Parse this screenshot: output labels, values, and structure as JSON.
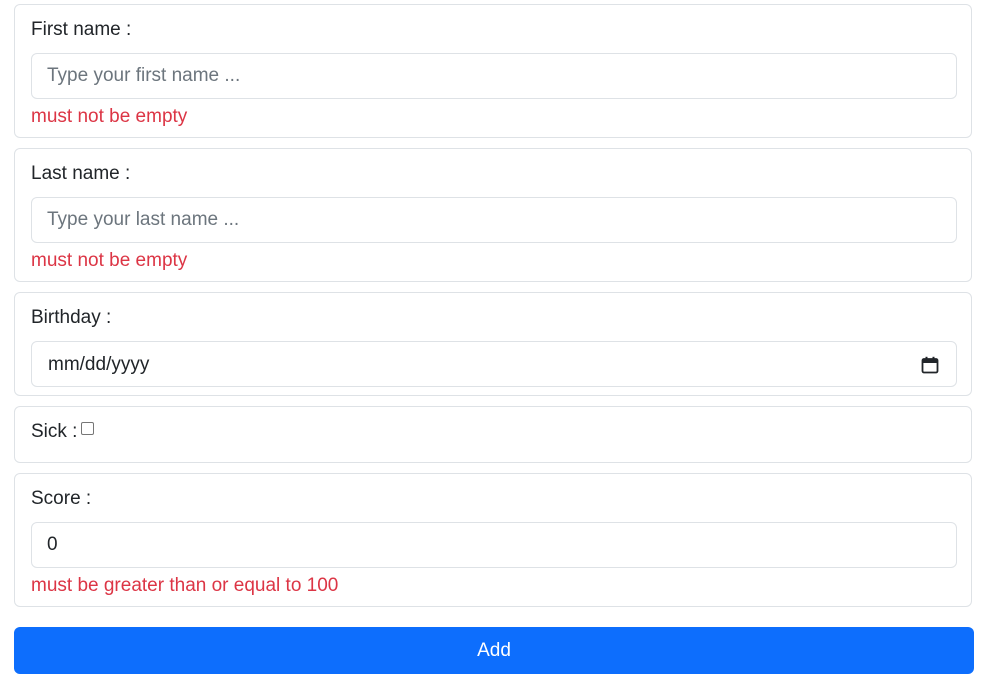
{
  "form": {
    "first_name": {
      "label": "First name :",
      "placeholder": "Type your first name ...",
      "value": "",
      "error": "must not be empty"
    },
    "last_name": {
      "label": "Last name :",
      "placeholder": "Type your last name ...",
      "value": "",
      "error": "must not be empty"
    },
    "birthday": {
      "label": "Birthday :",
      "display": "mm/dd/yyyy"
    },
    "sick": {
      "label": "Sick :",
      "checked": false
    },
    "score": {
      "label": "Score :",
      "value": "0",
      "error": "must be greater than or equal to 100"
    },
    "submit_label": "Add"
  },
  "colors": {
    "error": "#dc3545",
    "primary": "#0d6efd",
    "border": "#dee2e6",
    "text": "#212529"
  },
  "icons": {
    "birthday_picker": "calendar-icon"
  }
}
